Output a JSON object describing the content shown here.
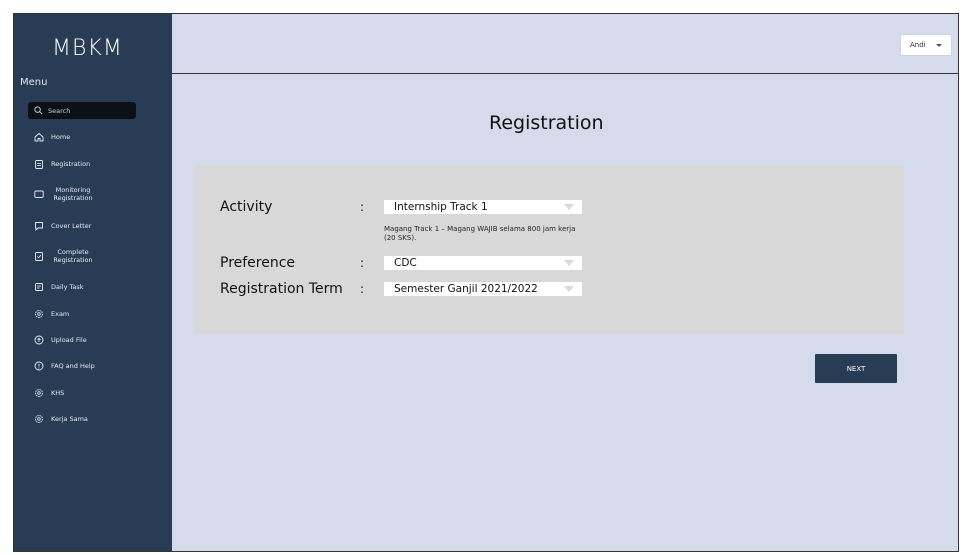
{
  "app": {
    "logo": "MBKM"
  },
  "sidebar": {
    "menu_label": "Menu",
    "search_placeholder": "Search",
    "items": [
      {
        "label": "Home",
        "icon": "home-icon"
      },
      {
        "label": "Registration",
        "icon": "clipboard-icon"
      },
      {
        "label": "Monitoring Registration",
        "icon": "wallet-icon"
      },
      {
        "label": "Cover Letter",
        "icon": "message-icon"
      },
      {
        "label": "Complete Registration",
        "icon": "clipboard-check-icon"
      },
      {
        "label": "Daily Task",
        "icon": "task-icon"
      },
      {
        "label": "Exam",
        "icon": "gear-icon"
      },
      {
        "label": "Upload File",
        "icon": "upload-icon"
      },
      {
        "label": "FAQ and Help",
        "icon": "help-icon"
      },
      {
        "label": "KHS",
        "icon": "gear-icon"
      },
      {
        "label": "Kerja Sama",
        "icon": "gear-icon"
      }
    ]
  },
  "header": {
    "user": "Andi"
  },
  "main": {
    "title": "Registration",
    "form": {
      "activity_label": "Activity",
      "activity_value": "Internship Track 1",
      "activity_helper": "Magang Track 1 – Magang WAJIB selama 800 jam kerja (20 SKS).",
      "preference_label": "Preference",
      "preference_value": "CDC",
      "term_label": "Registration Term",
      "term_value": "Semester Ganjil 2021/2022",
      "colon": ":"
    },
    "next_label": "NEXT"
  }
}
